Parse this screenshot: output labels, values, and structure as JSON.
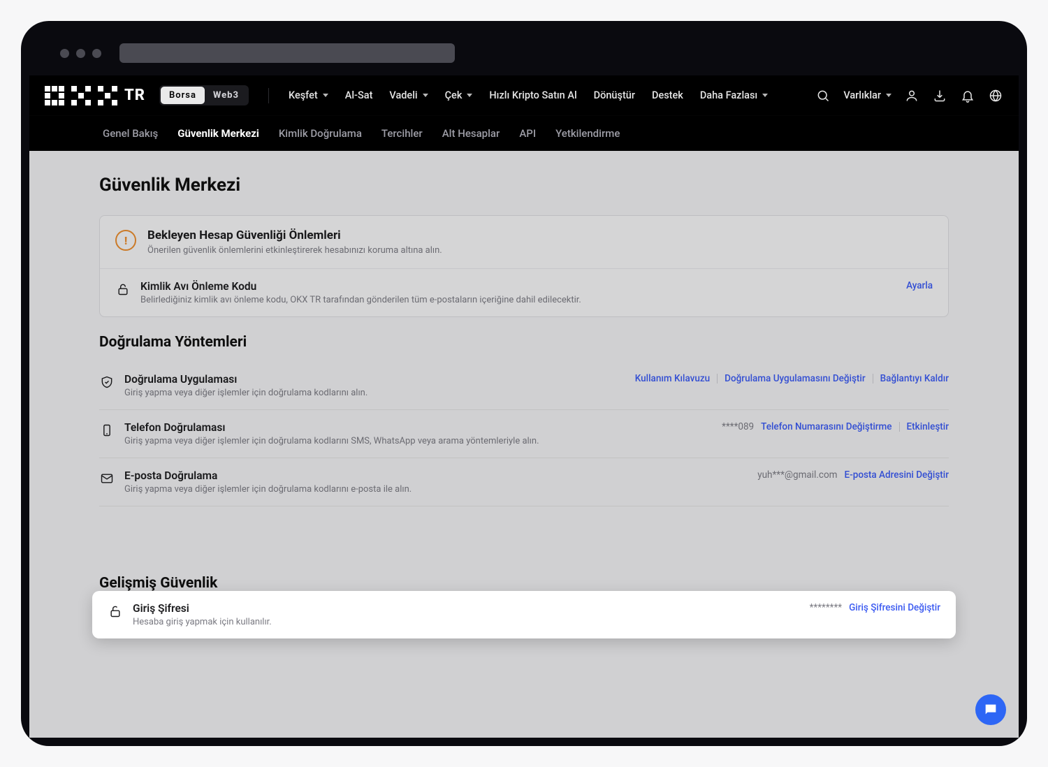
{
  "brand": {
    "text": "TR"
  },
  "segmented": {
    "borsa": "Borsa",
    "web3": "Web3"
  },
  "nav": [
    {
      "label": "Keşfet",
      "dropdown": true
    },
    {
      "label": "Al-Sat",
      "dropdown": false
    },
    {
      "label": "Vadeli",
      "dropdown": true
    },
    {
      "label": "Çek",
      "dropdown": true
    },
    {
      "label": "Hızlı Kripto Satın Al",
      "dropdown": false
    },
    {
      "label": "Dönüştür",
      "dropdown": false
    },
    {
      "label": "Destek",
      "dropdown": false
    },
    {
      "label": "Daha Fazlası",
      "dropdown": true
    }
  ],
  "assets_label": "Varlıklar",
  "subnav": [
    "Genel Bakış",
    "Güvenlik Merkezi",
    "Kimlik Doğrulama",
    "Tercihler",
    "Alt Hesaplar",
    "API",
    "Yetkilendirme"
  ],
  "page_title": "Güvenlik Merkezi",
  "alert": {
    "title": "Bekleyen Hesap Güvenliği Önlemleri",
    "sub": "Önerilen güvenlik önlemlerini etkinleştirerek hesabınızı koruma altına alın."
  },
  "phishing": {
    "title": "Kimlik Avı Önleme Kodu",
    "sub": "Belirlediğiniz kimlik avı önleme kodu, OKX TR tarafından gönderilen tüm e-postaların içeriğine dahil edilecektir.",
    "action": "Ayarla"
  },
  "section_verify": "Doğrulama Yöntemleri",
  "section_advanced": "Gelişmiş Güvenlik",
  "methods": {
    "auth_app": {
      "title": "Doğrulama Uygulaması",
      "sub": "Giriş yapma veya diğer işlemler için doğrulama kodlarını alın.",
      "a1": "Kullanım Kılavuzu",
      "a2": "Doğrulama Uygulamasını Değiştir",
      "a3": "Bağlantıyı Kaldır"
    },
    "phone": {
      "title": "Telefon Doğrulaması",
      "sub": "Giriş yapma veya diğer işlemler için doğrulama kodlarını SMS, WhatsApp veya arama yöntemleriyle alın.",
      "masked": "****089",
      "a1": "Telefon Numarasını Değiştirme",
      "a2": "Etkinleştir"
    },
    "email": {
      "title": "E-posta Doğrulama",
      "sub": "Giriş yapma veya diğer işlemler için doğrulama kodlarını e-posta ile alın.",
      "masked": "yuh***@gmail.com",
      "a1": "E-posta Adresini Değiştir"
    },
    "password": {
      "title": "Giriş Şifresi",
      "sub": "Hesaba giriş yapmak için kullanılır.",
      "masked": "********",
      "a1": "Giriş Şifresini Değiştir"
    }
  }
}
